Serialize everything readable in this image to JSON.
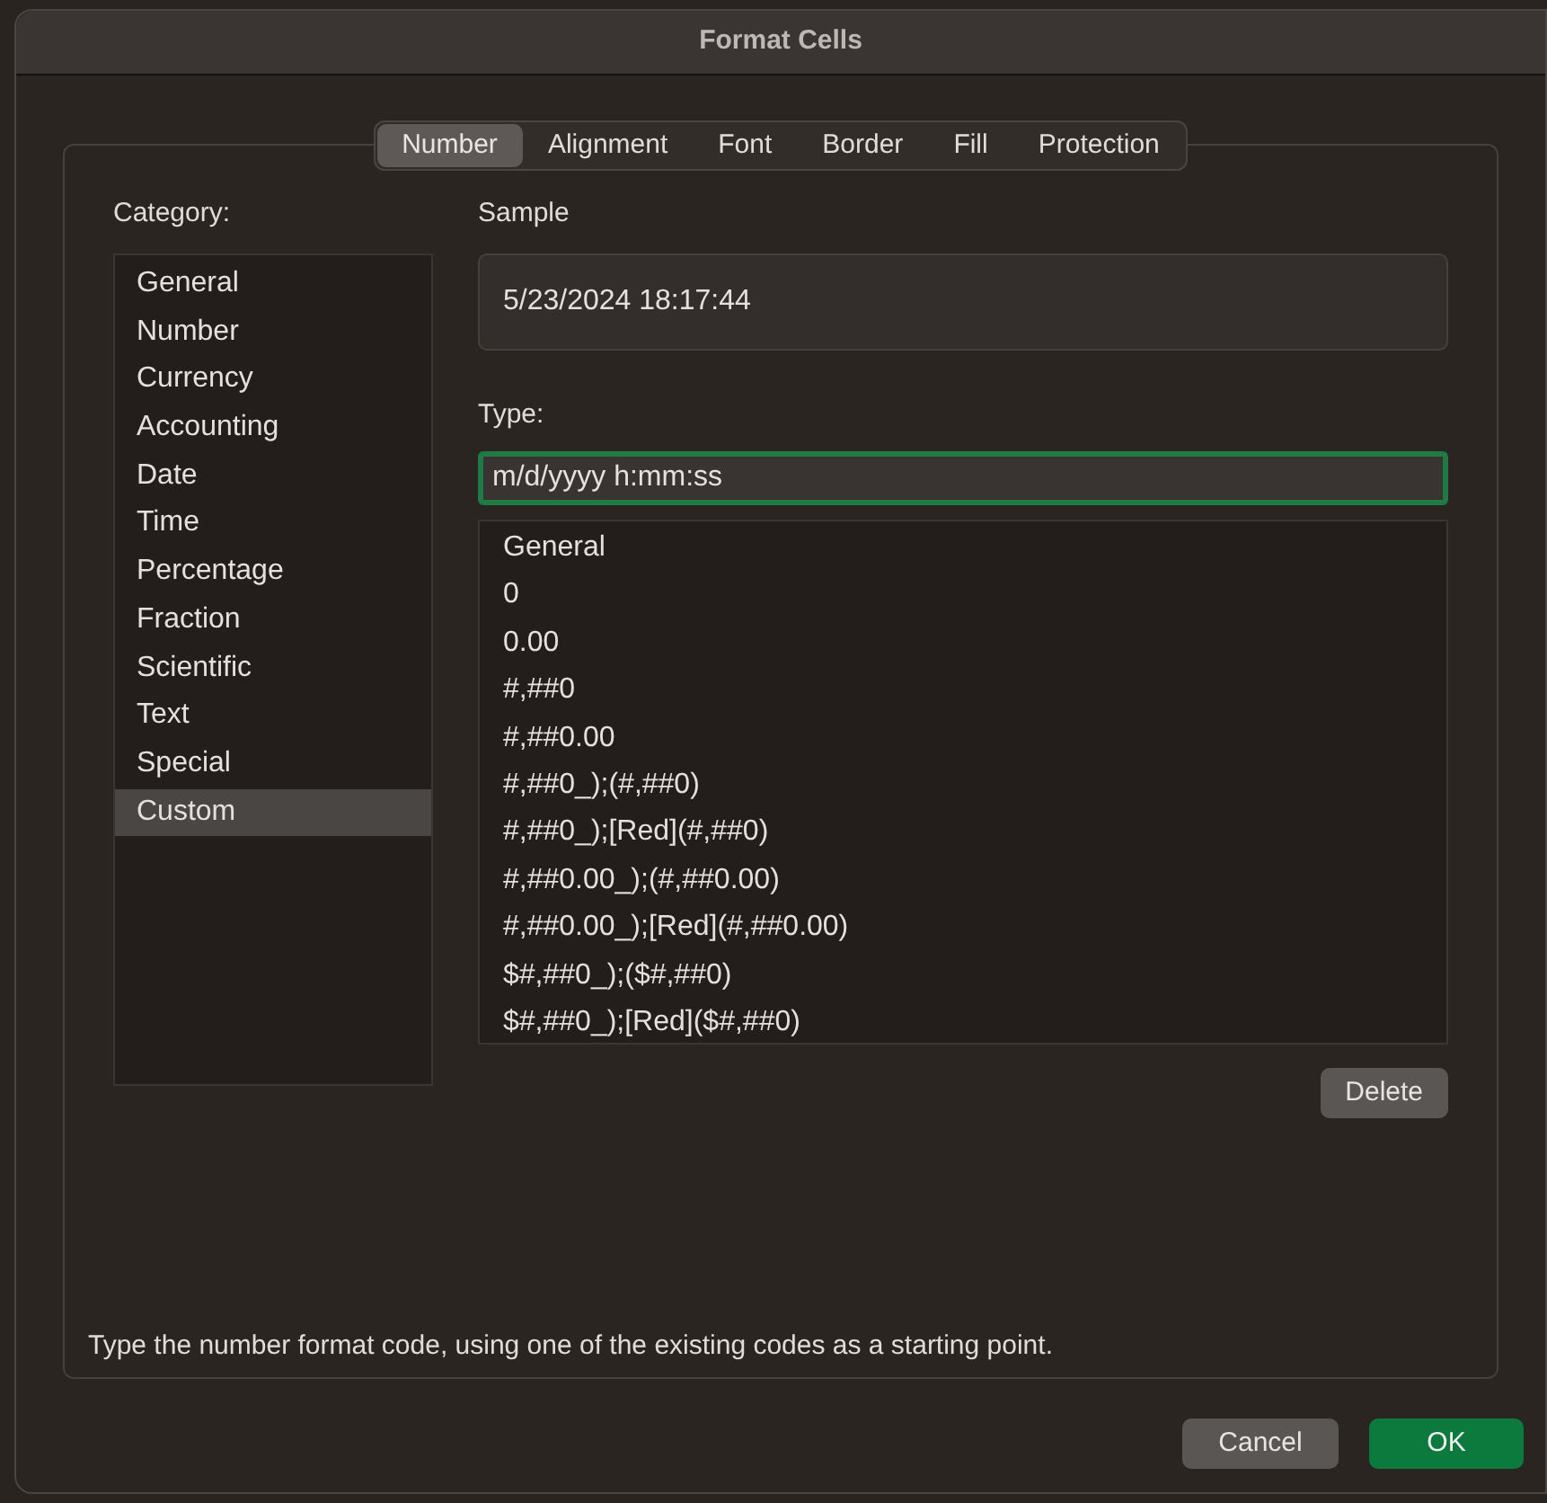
{
  "window": {
    "title": "Format Cells"
  },
  "tabs": [
    {
      "label": "Number",
      "selected": true
    },
    {
      "label": "Alignment",
      "selected": false
    },
    {
      "label": "Font",
      "selected": false
    },
    {
      "label": "Border",
      "selected": false
    },
    {
      "label": "Fill",
      "selected": false
    },
    {
      "label": "Protection",
      "selected": false
    }
  ],
  "category": {
    "label": "Category:",
    "items": [
      {
        "label": "General",
        "selected": false
      },
      {
        "label": "Number",
        "selected": false
      },
      {
        "label": "Currency",
        "selected": false
      },
      {
        "label": "Accounting",
        "selected": false
      },
      {
        "label": "Date",
        "selected": false
      },
      {
        "label": "Time",
        "selected": false
      },
      {
        "label": "Percentage",
        "selected": false
      },
      {
        "label": "Fraction",
        "selected": false
      },
      {
        "label": "Scientific",
        "selected": false
      },
      {
        "label": "Text",
        "selected": false
      },
      {
        "label": "Special",
        "selected": false
      },
      {
        "label": "Custom",
        "selected": true
      }
    ]
  },
  "sample": {
    "label": "Sample",
    "value": "5/23/2024 18:17:44"
  },
  "type": {
    "label": "Type:",
    "value": "m/d/yyyy h:mm:ss"
  },
  "type_list": [
    "General",
    "0",
    "0.00",
    "#,##0",
    "#,##0.00",
    "#,##0_);(#,##0)",
    "#,##0_);[Red](#,##0)",
    "#,##0.00_);(#,##0.00)",
    "#,##0.00_);[Red](#,##0.00)",
    "$#,##0_);($#,##0)",
    "$#,##0_);[Red]($#,##0)"
  ],
  "delete_button": "Delete",
  "hint": "Type the number format code, using one of the existing codes as a starting point.",
  "buttons": {
    "cancel": "Cancel",
    "ok": "OK"
  }
}
